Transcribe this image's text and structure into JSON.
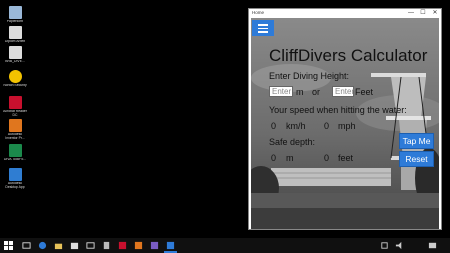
{
  "desktop": {
    "icons": [
      {
        "label": "Papierkorb",
        "color": "#9ab8d8"
      },
      {
        "label": "Diplom Arbeit",
        "color": "#dddddd"
      },
      {
        "label": "BRB_DIVE...",
        "color": "#dddddd"
      },
      {
        "label": "Norton Security",
        "color": "#f2c200"
      },
      {
        "label": "Acrobat Reader DC",
        "color": "#c8102e"
      },
      {
        "label": "Autodesk Inventor Pr...",
        "color": "#e0761e"
      },
      {
        "label": "DIVA Tool/Fo...",
        "color": "#1b8a4c"
      },
      {
        "label": "Autodesk Desktop App",
        "color": "#2f7dd2"
      }
    ]
  },
  "window": {
    "title": "Home",
    "minimize_glyph": "—",
    "maximize_glyph": "☐",
    "close_glyph": "✕"
  },
  "app": {
    "title": "CliffDivers Calculator",
    "enter_height_label": "Enter Diving Height:",
    "meters_placeholder": "Enter",
    "meters_unit": "m",
    "or_label": "or",
    "feet_placeholder": "Enter",
    "feet_unit": "Feet",
    "speed_label": "Your speed when hitting the water:",
    "speed_kmh_value": "0",
    "speed_kmh_unit": "km/h",
    "speed_mph_value": "0",
    "speed_mph_unit": "mph",
    "safe_depth_label": "Safe depth:",
    "depth_m_value": "0",
    "depth_m_unit": "m",
    "depth_ft_value": "0",
    "depth_ft_unit": "feet",
    "tap_me_button": "Tap Me",
    "reset_button": "Reset"
  },
  "taskbar": {
    "accent": "#2e7bd8"
  }
}
